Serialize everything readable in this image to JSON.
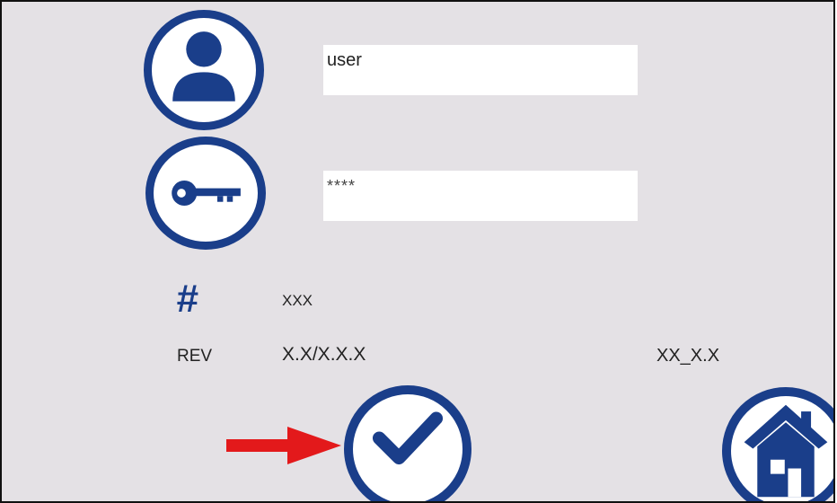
{
  "login": {
    "username_value": "user",
    "password_value": "****"
  },
  "info": {
    "serial_symbol": "#",
    "serial_value": "XXX",
    "rev_label": "REV",
    "rev_value": "X.X/X.X.X",
    "rev_secondary_value": "XX_X.X"
  },
  "icons": {
    "user": "user-icon",
    "key": "key-icon",
    "confirm": "checkmark-icon",
    "home": "home-icon",
    "pointer": "red-arrow"
  },
  "colors": {
    "background": "#e4e1e5",
    "accent": "#1a3e8a",
    "arrow": "#e3191b",
    "field": "#ffffff"
  }
}
